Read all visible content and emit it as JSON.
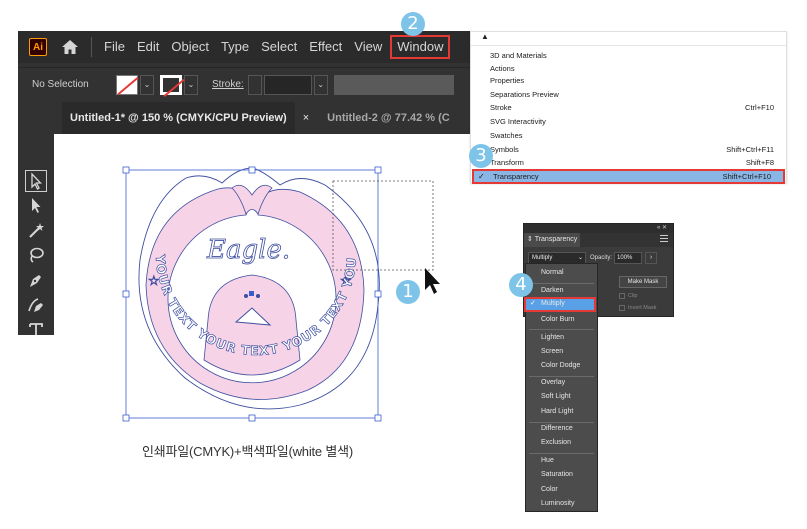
{
  "menubar": {
    "logo": "Ai",
    "items": [
      "File",
      "Edit",
      "Object",
      "Type",
      "Select",
      "Effect",
      "View"
    ],
    "active_item": "Window"
  },
  "controlbar": {
    "selection_status": "No Selection",
    "stroke_label": "Stroke:"
  },
  "tabs": {
    "active": "Untitled-1* @ 150 % (CMYK/CPU Preview)",
    "close": "×",
    "inactive": "Untitled-2 @ 77.42 % (C"
  },
  "artwork": {
    "script_text": "Eagle.",
    "ring_text_left": "YOUR TEXT",
    "ring_text_bottom": "YOUR TEXT YOUR TEXT",
    "ring_text_right": "YOUR TEXT",
    "fill_color": "#f6d3e6",
    "stroke_color": "#3d4ea0"
  },
  "caption": "인쇄파일(CMYK)+백색파일(white 별색)",
  "window_menu": {
    "items": [
      {
        "label": "3D and Materials",
        "shortcut": ""
      },
      {
        "label": "Actions",
        "shortcut": ""
      },
      {
        "label": "Properties",
        "shortcut": ""
      },
      {
        "label": "Separations Preview",
        "shortcut": ""
      },
      {
        "label": "Stroke",
        "shortcut": "Ctrl+F10"
      },
      {
        "label": "SVG Interactivity",
        "shortcut": ""
      },
      {
        "label": "Swatches",
        "shortcut": ""
      },
      {
        "label": "Symbols",
        "shortcut": "Shift+Ctrl+F11"
      },
      {
        "label": "Transform",
        "shortcut": "Shift+F8"
      },
      {
        "label": "Transparency",
        "shortcut": "Shift+Ctrl+F10"
      }
    ],
    "checked_item": "Transparency"
  },
  "transparency_panel": {
    "tab_label": "Transparency",
    "blend_mode": "Multiply",
    "opacity_label": "Opacity:",
    "opacity_value": "100%",
    "make_mask_label": "Make Mask",
    "clip_label": "Clip",
    "invert_mask_label": "Invert Mask"
  },
  "blend_modes": {
    "groups": [
      [
        "Normal",
        "Darken",
        "Multiply",
        "Color Burn"
      ],
      [
        "Lighten",
        "Screen",
        "Color Dodge"
      ],
      [
        "Overlay",
        "Soft Light",
        "Hard Light"
      ],
      [
        "Difference",
        "Exclusion"
      ],
      [
        "Hue",
        "Saturation",
        "Color",
        "Luminosity"
      ]
    ],
    "selected": "Multiply"
  },
  "badges": [
    "1",
    "2",
    "3",
    "4"
  ]
}
